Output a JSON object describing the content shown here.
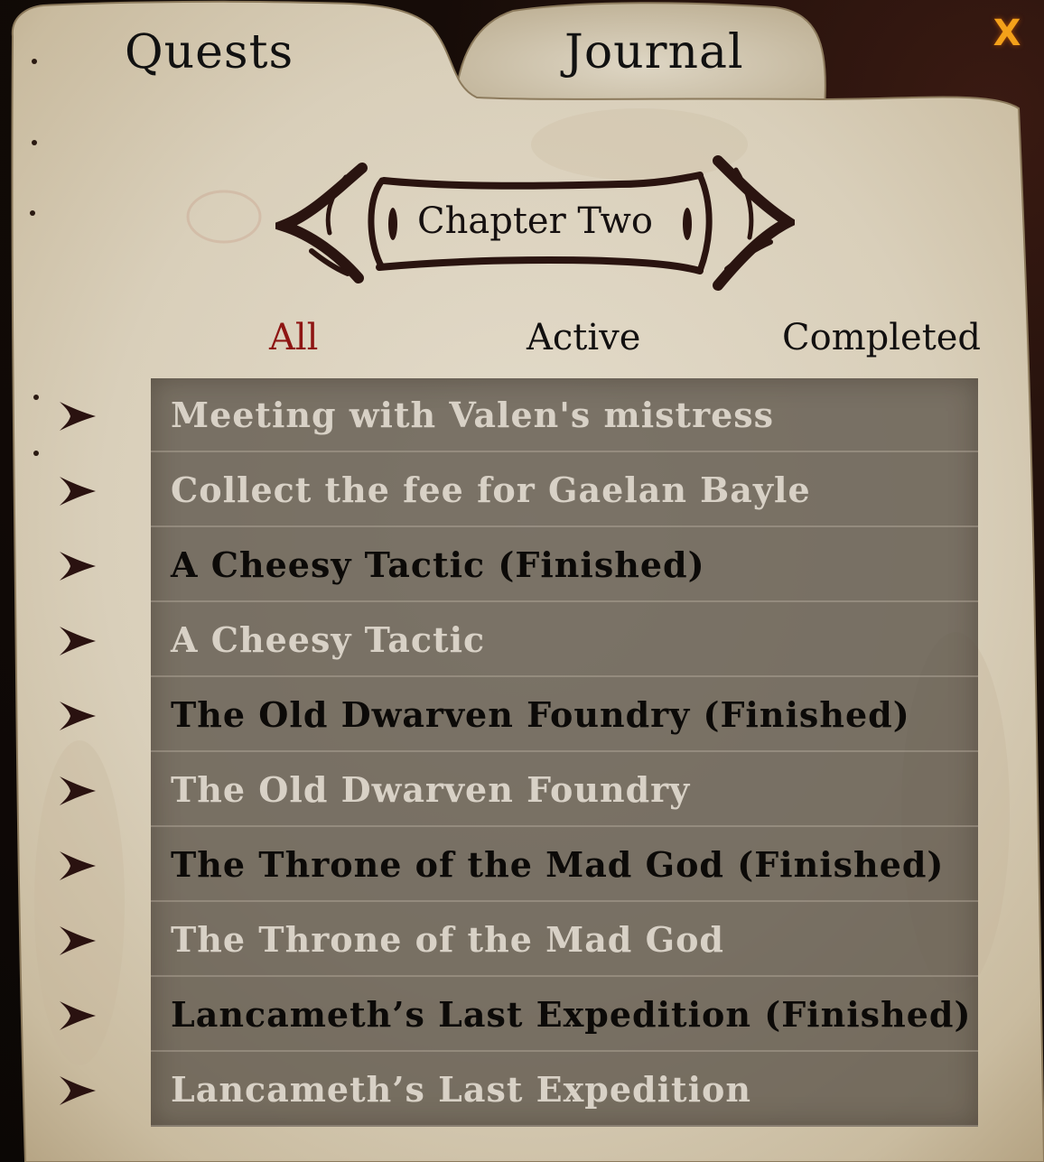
{
  "tabs": {
    "quests": "Quests",
    "journal": "Journal"
  },
  "close_label": "X",
  "chapter": "Chapter Two",
  "filters": {
    "all": "All",
    "active": "Active",
    "completed": "Completed",
    "selected": "all"
  },
  "quests": [
    {
      "title": "Meeting with Valen's mistress",
      "finished": false
    },
    {
      "title": "Collect the fee for Gaelan Bayle",
      "finished": false
    },
    {
      "title": "A Cheesy Tactic (Finished)",
      "finished": true
    },
    {
      "title": "A Cheesy Tactic",
      "finished": false
    },
    {
      "title": "The Old Dwarven Foundry (Finished)",
      "finished": true
    },
    {
      "title": "The Old Dwarven Foundry",
      "finished": false
    },
    {
      "title": "The Throne of the Mad God (Finished)",
      "finished": true
    },
    {
      "title": "The Throne of the Mad God",
      "finished": false
    },
    {
      "title": "Lancameth’s Last Expedition (Finished)",
      "finished": true
    },
    {
      "title": "Lancameth’s Last Expedition",
      "finished": false
    }
  ],
  "colors": {
    "selected_filter": "#8e1513",
    "close_button": "#f3a11a",
    "finished_text": "#0c0a08",
    "active_text": "#d8d1c6",
    "arrow": "#2a1210"
  },
  "icons": {
    "close": "close-icon",
    "row_marker": "arrow-right-icon",
    "banner": "scroll-banner-ornament"
  }
}
